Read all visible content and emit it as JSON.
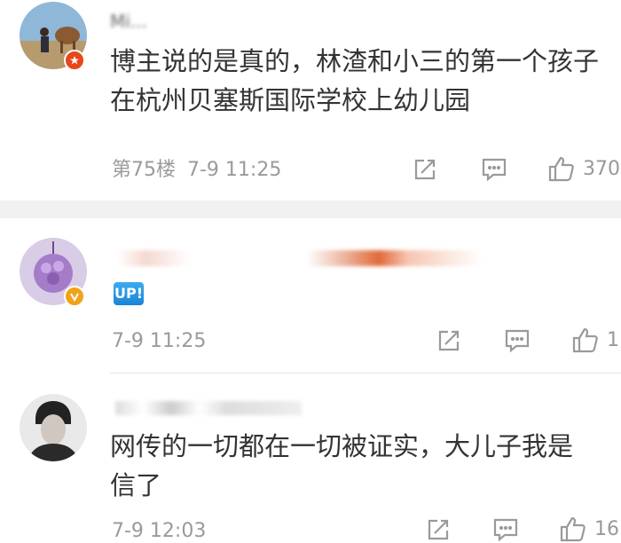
{
  "comments": [
    {
      "username": "Mi...",
      "text_lines": [
        "博主说的是真的，林渣和小三的第一个孩子",
        "在杭州贝塞斯国际学校上幼儿园"
      ],
      "floor": "第75楼",
      "time": "7-9 11:25",
      "likes": "370"
    },
    {
      "username": "",
      "emoji_text": "UP!",
      "time": "7-9 11:25",
      "likes": "1"
    },
    {
      "username": "",
      "text_lines": [
        "网传的一切都在一切被证实，大儿子我是",
        "信了"
      ],
      "time": "7-9 12:03",
      "likes": "16"
    }
  ],
  "colors": {
    "text": "#333333",
    "meta": "#9a9a9a",
    "badge_red": "#e8471b",
    "badge_orange": "#f0a21a",
    "up_blue": "#1a84d8"
  }
}
